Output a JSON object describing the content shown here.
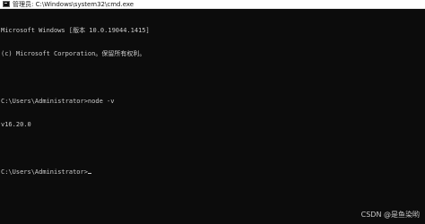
{
  "window": {
    "title": "管理员: C:\\Windows\\system32\\cmd.exe",
    "icon": "cmd-icon"
  },
  "console": {
    "lines": [
      "Microsoft Windows [版本 10.0.19044.1415]",
      "(c) Microsoft Corporation。保留所有权利。",
      "",
      "C:\\Users\\Administrator>node -v",
      "v16.20.0",
      "",
      "C:\\Users\\Administrator>"
    ]
  },
  "watermark": "CSDN @是鱼染哟",
  "colors": {
    "background": "#0c0c0c",
    "text": "#cccccc",
    "titlebar": "#ffffff"
  }
}
